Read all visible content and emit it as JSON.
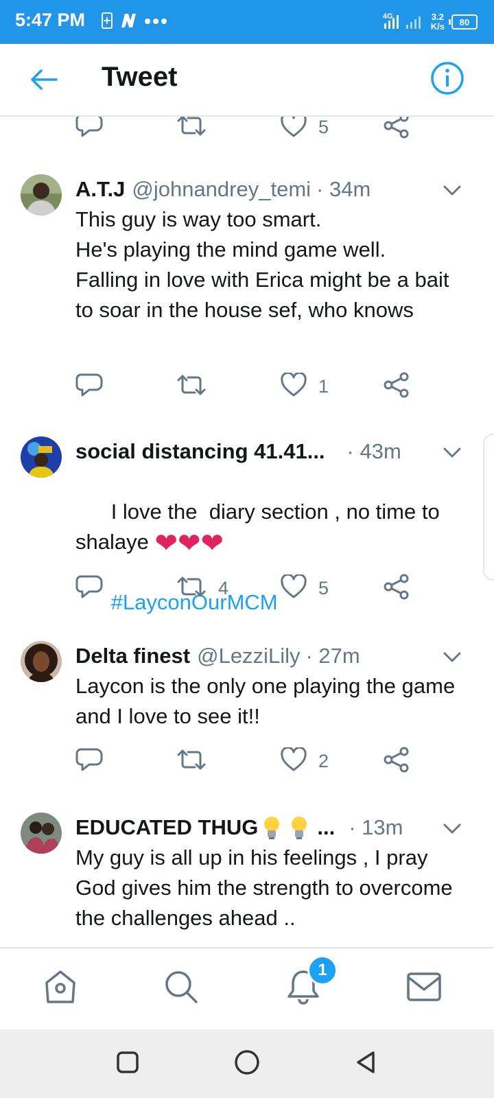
{
  "status_bar": {
    "time": "5:47 PM",
    "network": "4G",
    "speed_value": "3.2",
    "speed_unit": "K/s",
    "battery": "80",
    "icons": [
      "sim-icon",
      "notification-n-icon",
      "more-dots-icon",
      "signal-icon"
    ]
  },
  "app_bar": {
    "title": "Tweet",
    "back_icon": "back-arrow-icon",
    "info_icon": "info-icon"
  },
  "top_actions": {
    "like_count": "5"
  },
  "replies": [
    {
      "name": "A.T.J",
      "handle": "@johnandrey_temi",
      "time": "· 34m",
      "text": "This guy is way too smart.\nHe's playing the mind game well.\nFalling in love with Erica might be a bait to soar in the house sef, who knows",
      "retweets": "",
      "likes": "1"
    },
    {
      "name": "social distancing 41.41...",
      "handle": "",
      "time": "· 43m",
      "text": "I love the  diary section , no time to shalaye",
      "emoji": "❤❤❤",
      "hashtag": "#LayconOurMCM",
      "retweets": "4",
      "likes": "5"
    },
    {
      "name": "Delta finest",
      "handle": "@LezziLily",
      "time": "· 27m",
      "text": "Laycon is the only one playing the game and I love to see it!!",
      "retweets": "",
      "likes": "2"
    },
    {
      "name": "EDUCATED THUG",
      "name_suffix": "...",
      "handle": "",
      "time": "· 13m",
      "text": "My guy is all up in his feelings , I pray God gives him the strength to overcome the challenges ahead .."
    }
  ],
  "bottom_nav": {
    "items": [
      "home-icon",
      "search-icon",
      "notifications-icon",
      "messages-icon"
    ],
    "notification_badge": "1"
  },
  "system_nav": [
    "recents-square-icon",
    "home-circle-icon",
    "back-triangle-icon"
  ],
  "colors": {
    "status_bar": "#2196e8",
    "accent": "#1da1f2",
    "heart": "#e0245e",
    "secondary_text": "#657786"
  }
}
